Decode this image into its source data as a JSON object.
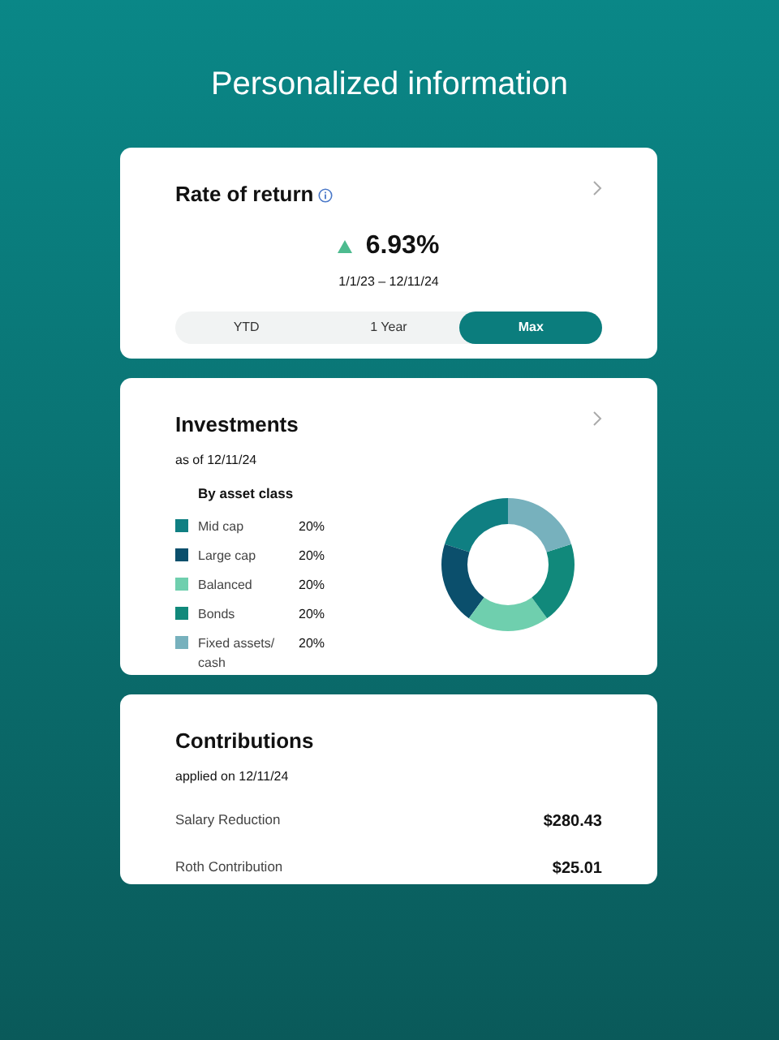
{
  "title": "Personalized information",
  "rate_of_return": {
    "title": "Rate of return",
    "up": true,
    "value": "6.93%",
    "period": "1/1/23 – 12/11/24",
    "ranges": [
      {
        "label": "YTD",
        "selected": false
      },
      {
        "label": "1 Year",
        "selected": false
      },
      {
        "label": "Max",
        "selected": true
      }
    ]
  },
  "investments": {
    "title": "Investments",
    "as_of": "as of 12/11/24",
    "legend": [
      {
        "value": "20%",
        "color": "#0f7f82"
      },
      {
        "value": "20%",
        "color": "#0b4f6c"
      },
      {
        "value": "20%",
        "color": "#6fcfae"
      },
      {
        "value": "20%",
        "color": "#11897b"
      },
      {
        "value": "20%",
        "color": "#77b1bd"
      }
    ],
    "chart_data": {
      "type": "donut",
      "categories": [
        "Mid cap",
        "Large cap",
        "Balanced",
        "Bonds",
        "Fixed assets/ cash"
      ],
      "series": [
        {
          "name": "By asset class",
          "values": [
            20,
            20,
            20,
            20,
            20
          ]
        }
      ]
    }
  },
  "contributions": {
    "title": "Contributions",
    "applied": "applied on 12/11/24",
    "rows": [
      {
        "label": "Salary Reduction",
        "amount": "$280.43"
      },
      {
        "label": "Roth Contribution",
        "amount": "$25.01"
      }
    ]
  }
}
